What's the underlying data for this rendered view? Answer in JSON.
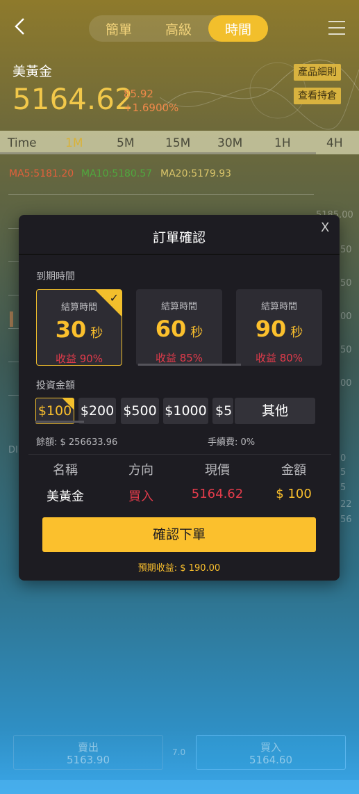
{
  "header": {
    "tabs": [
      "簡單",
      "高級",
      "時間"
    ],
    "active_tab": 2
  },
  "ticker": {
    "symbol": "美黃金",
    "price": "5164.62",
    "change": "85.92",
    "change_pct": "+1.6900%",
    "detail_button": "產品細則",
    "position_button": "查看持倉"
  },
  "timeframes": {
    "label": "Time",
    "items": [
      "1M",
      "5M",
      "15M",
      "30M",
      "1H",
      "4H"
    ],
    "active": "1M"
  },
  "indicators": {
    "ma5": "MA5:5181.20",
    "ma10": "MA10:5180.57",
    "ma20": "MA20:5179.93"
  },
  "chart_bg": {
    "axis_label": "5185.00",
    "side_labels": [
      "50",
      "50",
      "00",
      "50",
      "00",
      "50"
    ],
    "right_edge": [
      "0",
      "5",
      "5",
      "22",
      "56"
    ],
    "left_fragment": "DI"
  },
  "modal": {
    "title": "訂單確認",
    "close": "X",
    "expiry_label": "到期時間",
    "expiry_options": [
      {
        "subtitle": "結算時間",
        "value": "30",
        "unit": "秒",
        "rate": "收益 90%",
        "selected": true
      },
      {
        "subtitle": "結算時間",
        "value": "60",
        "unit": "秒",
        "rate": "收益 85%",
        "selected": false
      },
      {
        "subtitle": "結算時間",
        "value": "90",
        "unit": "秒",
        "rate": "收益 80%",
        "selected": false
      }
    ],
    "amount_label": "投資金額",
    "amounts": [
      "$100",
      "$200",
      "$500",
      "$1000",
      "$5"
    ],
    "selected_amount": "$100",
    "other_button": "其他",
    "balance": "餘額: $ 256633.96",
    "fee": "手續費: 0%",
    "table": {
      "headers": [
        "名稱",
        "方向",
        "現價",
        "金額"
      ],
      "row": {
        "name": "美黃金",
        "direction": "買入",
        "price": "5164.62",
        "amount": "$ 100"
      }
    },
    "confirm_button": "確認下單",
    "expected": "預期收益: $ 190.00"
  },
  "bottom": {
    "sell_label": "賣出",
    "sell_price": "5163.90",
    "spread": "7.0",
    "buy_label": "買入",
    "buy_price": "5164.60"
  },
  "colors": {
    "accent": "#fbc02d",
    "down_red": "#e23b4b",
    "modal_bg": "#1d1c22"
  }
}
